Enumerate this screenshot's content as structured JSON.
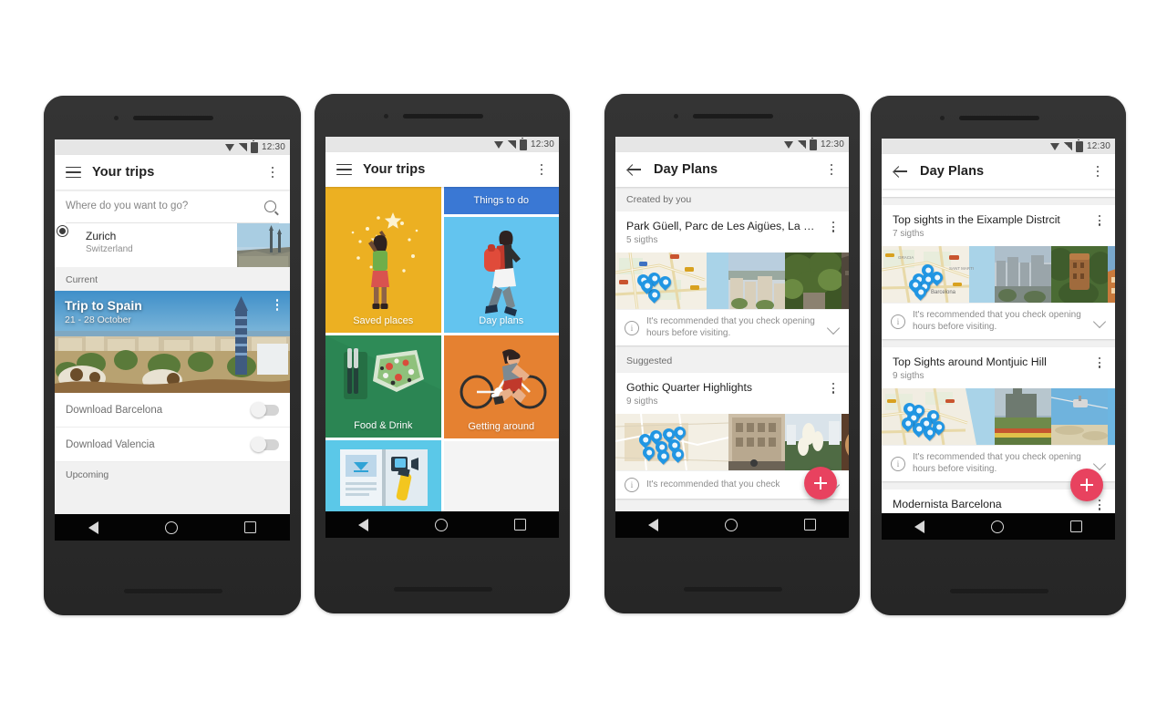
{
  "statusbar": {
    "time": "12:30",
    "icons": [
      "wifi-icon",
      "signal-icon",
      "battery-icon"
    ]
  },
  "navbar": {
    "back": "back-triangle-icon",
    "home": "home-circle-icon",
    "recents": "recents-square-icon"
  },
  "phone1": {
    "appbar": {
      "title": "Your trips",
      "menu_icon": "hamburger-icon",
      "overflow_icon": "kebab-icon"
    },
    "search": {
      "placeholder": "Where do you want to go?",
      "icon": "search-icon"
    },
    "suggestion": {
      "name": "Zurich",
      "country": "Switzerland",
      "icon": "my-location-icon"
    },
    "section_current": "Current",
    "trip": {
      "title": "Trip to Spain",
      "dates": "21 - 28 October",
      "overflow_icon": "kebab-icon"
    },
    "downloads": [
      {
        "label": "Download Barcelona",
        "state": "off"
      },
      {
        "label": "Download Valencia",
        "state": "off"
      }
    ],
    "section_upcoming": "Upcoming"
  },
  "phone2": {
    "appbar": {
      "title": "Your trips",
      "menu_icon": "hamburger-icon",
      "overflow_icon": "kebab-icon"
    },
    "tiles": [
      {
        "label": "Saved places",
        "color": "#ecb022",
        "art": "person-stars"
      },
      {
        "label": "Things to do",
        "color": "#3a78d4",
        "art": "none"
      },
      {
        "label": "Day plans",
        "color": "#63c4ef",
        "art": "walking-backpacker"
      },
      {
        "label": "Food & Drink",
        "color": "#2e8b57",
        "art": "salad-cutlery"
      },
      {
        "label": "Getting around",
        "color": "#e58131",
        "art": "cyclist"
      },
      {
        "label": "",
        "color": "#5bc8e8",
        "art": "open-book"
      }
    ]
  },
  "phone3": {
    "appbar": {
      "title": "Day Plans",
      "back_icon": "back-arrow-icon",
      "overflow_icon": "kebab-icon"
    },
    "sections": [
      {
        "label": "Created by you",
        "cards": [
          {
            "title": "Park Güell, Parc de Les Aigües, La Sa…",
            "subtitle": "5 sigths",
            "note": "It's recommended that you check opening hours before visiting.",
            "overflow_icon": "kebab-icon",
            "expand_icon": "chevron-down-icon"
          }
        ]
      },
      {
        "label": "Suggested",
        "cards": [
          {
            "title": "Gothic Quarter Highlights",
            "subtitle": "9 sigths",
            "note": "It's recommended that you check",
            "overflow_icon": "kebab-icon",
            "expand_icon": "chevron-down-icon"
          }
        ]
      }
    ],
    "fab": {
      "icon": "plus-icon",
      "color": "#e8425f"
    }
  },
  "phone4": {
    "appbar": {
      "title": "Day Plans",
      "back_icon": "back-arrow-icon",
      "overflow_icon": "kebab-icon"
    },
    "cards": [
      {
        "title": "Top sights in the Eixample Distrcit",
        "subtitle": "7 sigths",
        "note": "It's recommended that you check opening hours before visiting.",
        "overflow_icon": "kebab-icon",
        "expand_icon": "chevron-down-icon"
      },
      {
        "title": "Top Sights around Montjuic Hill",
        "subtitle": "9 sigths",
        "note": "It's recommended that you check opening hours before visiting.",
        "overflow_icon": "kebab-icon",
        "expand_icon": "chevron-down-icon"
      },
      {
        "title": "Modernista Barcelona",
        "subtitle": "",
        "note": "",
        "overflow_icon": "kebab-icon",
        "expand_icon": "chevron-down-icon"
      }
    ],
    "fab": {
      "icon": "plus-icon",
      "color": "#e8425f"
    }
  }
}
